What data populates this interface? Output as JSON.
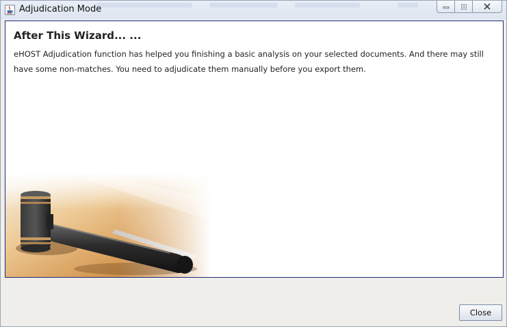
{
  "window": {
    "title": "Adjudication Mode",
    "icon": "java-cup-icon",
    "controls": {
      "minimize_icon": "minimize-icon",
      "maximize_icon": "maximize-icon",
      "close_icon": "close-icon"
    }
  },
  "content": {
    "heading": "After This Wizard... ...",
    "paragraph": "eHOST Adjudication function has helped you finishing a basic analysis on your selected documents. And there may still have some non-matches. You need to adjudicate them manually before you export them.",
    "image": "gavel-photo"
  },
  "footer": {
    "close_label": "Close"
  },
  "colors": {
    "panel_border": "#1e2b7a",
    "panel_background": "#ffffff",
    "window_background": "#efeeea"
  }
}
